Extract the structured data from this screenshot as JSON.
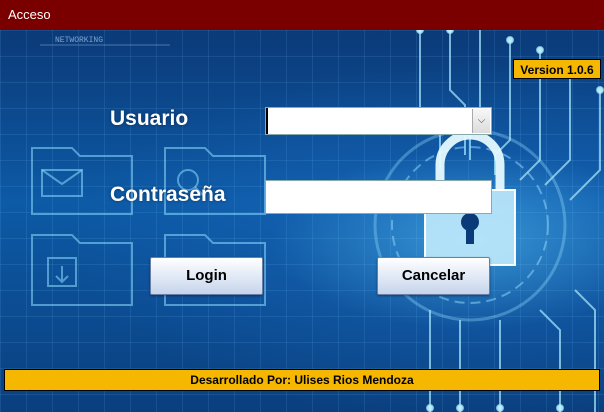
{
  "window": {
    "title": "Acceso"
  },
  "version": "Version 1.0.6",
  "form": {
    "user_label": "Usuario",
    "user_value": "",
    "password_label": "Contraseña",
    "password_value": ""
  },
  "buttons": {
    "login": "Login",
    "cancel": "Cancelar"
  },
  "footer": "Desarrollado Por: Ulises Rios Mendoza",
  "background": {
    "networking_text": "NETWORKING"
  },
  "colors": {
    "titlebar": "#7a0000",
    "accent": "#f5b700"
  }
}
